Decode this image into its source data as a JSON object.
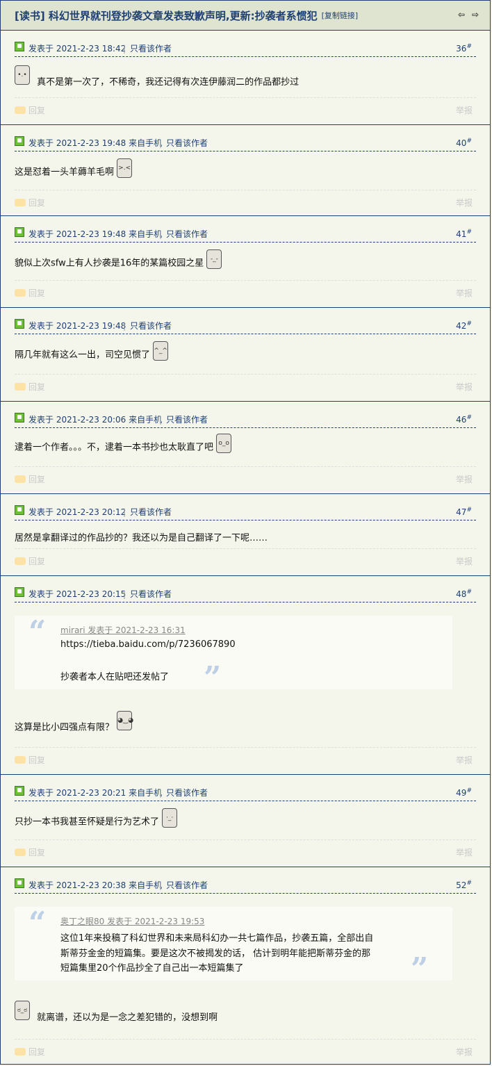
{
  "thread": {
    "title": "[读书] 科幻世界就刊登抄袭文章发表致歉声明,更新:抄袭者系惯犯",
    "copy_link": "[复制链接]"
  },
  "labels": {
    "reply": "回复",
    "report": "举报",
    "only_author": "只看该作者",
    "posted_at": "发表于"
  },
  "posts": [
    {
      "meta": "发表于 2021-2-23 18:42",
      "floor": "36",
      "text": "真不是第一次了，不稀奇，我还记得有次连伊藤润二的作品都抄过",
      "emoticon": "smiley-face-icon"
    },
    {
      "meta": "发表于 2021-2-23 19:48 来自手机",
      "floor": "40",
      "text": "这是怼着一头羊薅羊毛啊",
      "emoticon": "smiley-face-icon"
    },
    {
      "meta": "发表于 2021-2-23 19:48 来自手机",
      "floor": "41",
      "text": "貌似上次sfw上有人抄袭是16年的某篇校园之星",
      "emoticon": "smiley-face-icon"
    },
    {
      "meta": "发表于 2021-2-23 19:48",
      "floor": "42",
      "text": "隔几年就有这么一出，司空见惯了",
      "emoticon": "smiley-face-icon"
    },
    {
      "meta": "发表于 2021-2-23 20:06 来自手机",
      "floor": "46",
      "text": "逮着一个作者。。。不，逮着一本书抄也太耿直了吧",
      "emoticon": "smiley-face-icon"
    },
    {
      "meta": "发表于 2021-2-23 20:12",
      "floor": "47",
      "text": "居然是拿翻译过的作品抄的？我还以为是自己翻译了一下呢……"
    },
    {
      "meta": "发表于 2021-2-23 20:15",
      "floor": "48",
      "quote": {
        "header": "mirari 发表于 2021-2-23 16:31",
        "lines": [
          "https://tieba.baidu.com/p/7236067890",
          "",
          "抄袭者本人在贴吧还发帖了"
        ]
      },
      "text": "这算是比小四强点有限？",
      "emoticon": "smiley-face-icon"
    },
    {
      "meta": "发表于 2021-2-23 20:21 来自手机",
      "floor": "49",
      "text": "只抄一本书我甚至怀疑是行为艺术了",
      "emoticon": "smiley-face-icon"
    },
    {
      "meta": "发表于 2021-2-23 20:38 来自手机",
      "floor": "52",
      "quote": {
        "header": "奥丁之眼80 发表于 2021-2-23 19:53",
        "lines": [
          "这位1年来投稿了科幻世界和未来局科幻办一共七篇作品，抄袭五篇，全部出自",
          "斯蒂芬金金的短篇集。要是这次不被揭发的话， 估计到明年能把斯蒂芬金的那",
          "短篇集里20个作品抄全了自己出一本短篇集了"
        ]
      },
      "text": "就离谱，还以为是一念之差犯错的，没想到啊",
      "emoticon": "smiley-face-icon"
    }
  ]
}
